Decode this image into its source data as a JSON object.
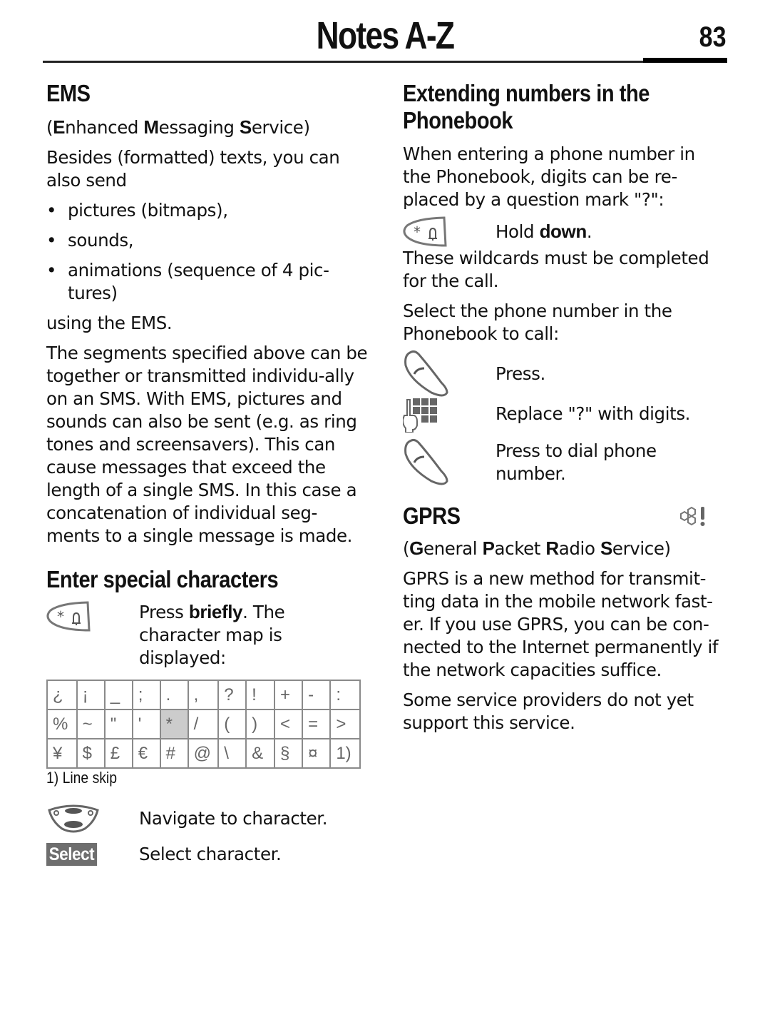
{
  "header": {
    "title": "Notes A-Z",
    "page_number": "83"
  },
  "ems": {
    "heading": "EMS",
    "expansion": [
      {
        "text": "(",
        "bold": false
      },
      {
        "text": "E",
        "bold": true
      },
      {
        "text": "nhanced ",
        "bold": false
      },
      {
        "text": "M",
        "bold": true
      },
      {
        "text": "essaging ",
        "bold": false
      },
      {
        "text": "S",
        "bold": true
      },
      {
        "text": "ervice)",
        "bold": false
      }
    ],
    "intro": "Besides (formatted) texts, you can also send",
    "bullets": [
      "pictures (bitmaps),",
      "sounds,",
      "animations (sequence of 4 pic-tures)"
    ],
    "after_bullets": "using the EMS.",
    "body": "The segments specified above can be together or transmitted individu-ally on an SMS. With EMS, pictures and sounds can also be sent (e.g. as ring tones and screensavers). This can cause messages that exceed the length of a single SMS. In this case a concatenation of individual seg-ments to a single message is made."
  },
  "special_chars": {
    "heading": "Enter special characters",
    "step1": {
      "icon": "star-bell-key-icon",
      "prefix": "Press ",
      "bold": "briefly",
      "suffix": ". The character map is displayed:"
    },
    "charmap": [
      [
        "¿",
        "¡",
        "_",
        ";",
        ".",
        ",",
        "?",
        "!",
        "+",
        "-",
        ":"
      ],
      [
        "%",
        "~",
        "\"",
        "'",
        "*",
        "/",
        "(",
        ")",
        "<",
        "=",
        ">"
      ],
      [
        "¥",
        "$",
        "£",
        "€",
        "#",
        "@",
        "\\",
        "&",
        "§",
        "¤",
        "1)"
      ]
    ],
    "highlighted_cell": "*",
    "footnote": "1) Line skip",
    "step2": {
      "icon": "navigation-key-icon",
      "text": "Navigate to character."
    },
    "step3": {
      "key_label": "Select",
      "text": "Select character."
    }
  },
  "extending": {
    "heading_line1": "Extending numbers in the",
    "heading_line2": "Phonebook",
    "intro": "When entering a phone number in the Phonebook, digits can be re-placed by a question mark \"?\":",
    "hold": {
      "prefix": "Hold ",
      "bold": "down",
      "suffix": "."
    },
    "wildcards": "These wildcards must be completed for the call.",
    "select": "Select the phone number in the Phonebook to call:",
    "steps": [
      {
        "icon": "call-key-icon",
        "text": "Press."
      },
      {
        "icon": "keypad-icon",
        "text": "Replace \"?\" with digits."
      },
      {
        "icon": "call-key-icon",
        "text": "Press to dial phone number."
      }
    ]
  },
  "gprs": {
    "heading": "GPRS",
    "icon": "network-service-icon",
    "expansion": [
      {
        "text": "(",
        "bold": false
      },
      {
        "text": "G",
        "bold": true
      },
      {
        "text": "eneral ",
        "bold": false
      },
      {
        "text": "P",
        "bold": true
      },
      {
        "text": "acket ",
        "bold": false
      },
      {
        "text": "R",
        "bold": true
      },
      {
        "text": "adio ",
        "bold": false
      },
      {
        "text": "S",
        "bold": true
      },
      {
        "text": "ervice)",
        "bold": false
      }
    ],
    "body": "GPRS is a new method for transmit-ting data in the mobile network fast-er. If you use GPRS, you can be con-nected to the Internet permanently if the network capacities suffice.",
    "note": "Some service providers do not yet support this service."
  }
}
